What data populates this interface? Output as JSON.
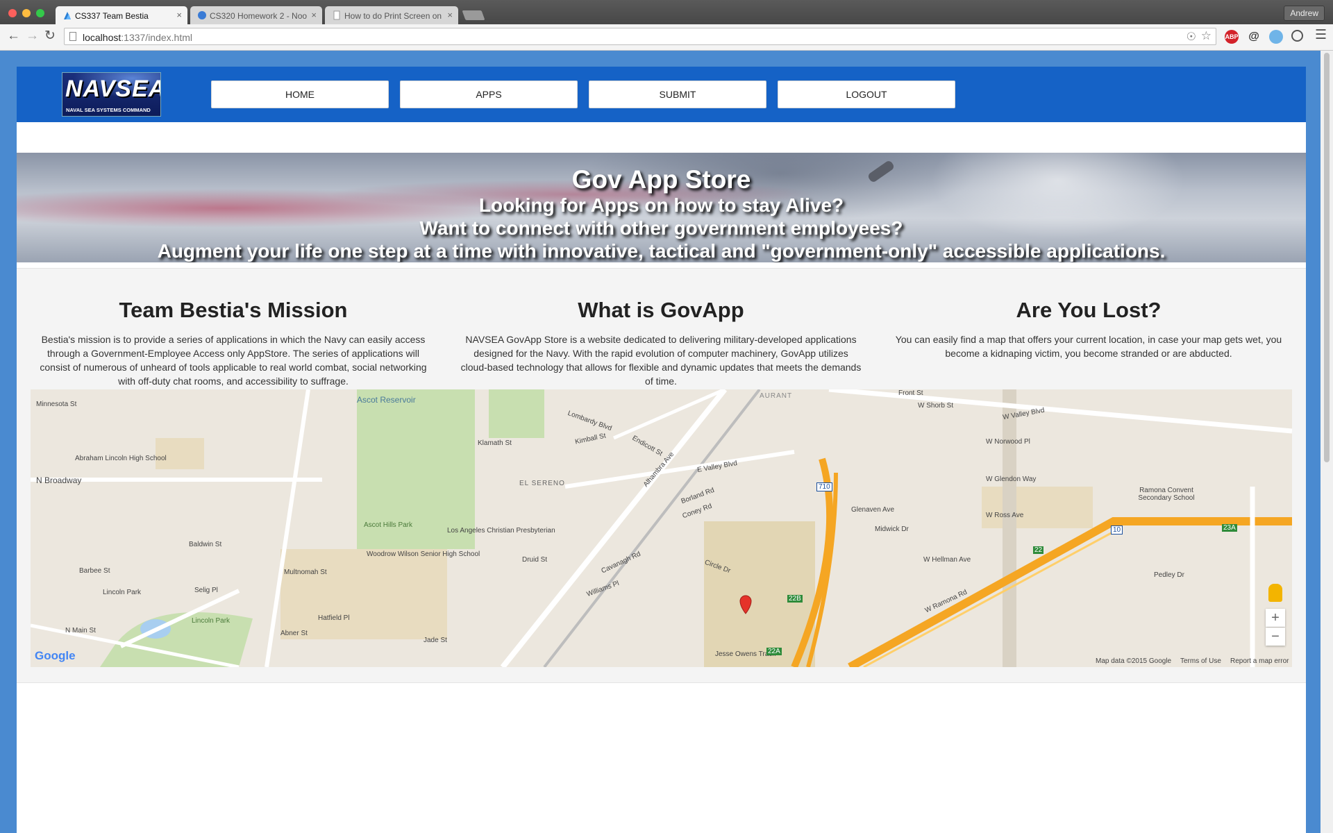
{
  "browser": {
    "tabs": [
      {
        "title": "CS337 Team Bestia",
        "close": "×"
      },
      {
        "title": "CS320 Homework 2 - Noo",
        "close": "×"
      },
      {
        "title": "How to do Print Screen on",
        "close": "×"
      }
    ],
    "profile": "Andrew",
    "url_host": "localhost",
    "url_rest": ":1337/index.html",
    "extensions": [
      "ABP",
      "@"
    ]
  },
  "header": {
    "logo_text": "NAVSEA",
    "logo_sub": "NAVAL SEA SYSTEMS COMMAND",
    "menu": [
      "HOME",
      "APPS",
      "SUBMIT",
      "LOGOUT"
    ]
  },
  "banner": {
    "title": "Gov App Store",
    "lines": [
      "Looking for Apps on how to stay Alive?",
      "Want to connect with other government employees?",
      "Augment your life one step at a time with innovative, tactical and \"government-only\" accessible applications."
    ]
  },
  "columns": [
    {
      "heading": "Team Bestia's Mission",
      "body": "Bestia's mission is to provide a series of applications in which the Navy can easily access through a Government-Employee Access only AppStore. The series of applications will consist of numerous of unheard of tools applicable to real world combat, social networking with off-duty chat rooms, and accessibility to suffrage."
    },
    {
      "heading": "What is GovApp",
      "body": "NAVSEA GovApp Store is a website dedicated to delivering military-developed applications designed for the Navy. With the rapid evolution of computer machinery, GovApp utilizes cloud-based technology that allows for flexible and dynamic updates that meets the demands of time."
    },
    {
      "heading": "Are You Lost?",
      "body": "You can easily find a map that offers your current location, in case your map gets wet, you become a kidnaping victim, you become stranded or are abducted."
    }
  ],
  "map": {
    "labels": [
      "Ascot Reservoir",
      "Minnesota St",
      "Abraham Lincoln High School",
      "N Broadway",
      "Baldwin St",
      "Barbee St",
      "Lincoln Park",
      "N Main St",
      "Abner St",
      "Multnomah St",
      "Hatfield Pl",
      "Ascot Hills Park",
      "Woodrow Wilson Senior High School",
      "Los Angeles Christian Presbyterian",
      "Klamath St",
      "EL SERENO",
      "Druid St",
      "Lombardy Blvd",
      "Kimball St",
      "Endicott St",
      "Alhambra Ave",
      "E Valley Blvd",
      "Borland Rd",
      "Coney Rd",
      "Circle Dr",
      "Williams Pl",
      "Cavanagh Rd",
      "Jesse Owens Track",
      "AURANT",
      "Front St",
      "W Shorb St",
      "W Valley Blvd",
      "W Norwood Pl",
      "W Glendon Way",
      "Ramona Convent Secondary School",
      "W Ross Ave",
      "Glenaven Ave",
      "Midwick Dr",
      "W Hellman Ave",
      "Pedley Dr",
      "W Ramona Rd",
      "Selig Pl",
      "Jade St",
      "Lincoln Park"
    ],
    "brand": "Google",
    "attribution": [
      "Map data ©2015 Google",
      "Terms of Use",
      "Report a map error"
    ],
    "zoom_in": "+",
    "zoom_out": "−",
    "road_shields": [
      "710",
      "10",
      "22",
      "22B",
      "22A",
      "23A"
    ]
  }
}
